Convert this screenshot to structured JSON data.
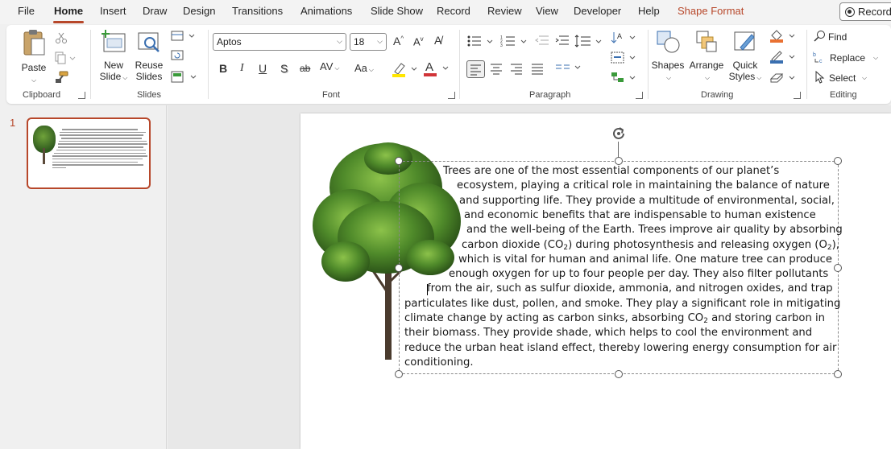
{
  "menu": {
    "file": "File",
    "home": "Home",
    "insert": "Insert",
    "draw": "Draw",
    "design": "Design",
    "transitions": "Transitions",
    "animations": "Animations",
    "slideshow": "Slide Show",
    "record": "Record",
    "review": "Review",
    "view": "View",
    "developer": "Developer",
    "help": "Help",
    "shape_format": "Shape Format",
    "record_button": "Record"
  },
  "ribbon": {
    "clipboard": {
      "label": "Clipboard",
      "paste": "Paste"
    },
    "slides": {
      "label": "Slides",
      "new_slide_1": "New",
      "new_slide_2": "Slide",
      "reuse_1": "Reuse",
      "reuse_2": "Slides"
    },
    "font": {
      "label": "Font",
      "family": "Aptos",
      "size": "18"
    },
    "paragraph": {
      "label": "Paragraph"
    },
    "drawing": {
      "label": "Drawing",
      "shapes": "Shapes",
      "arrange": "Arrange",
      "quick_styles_1": "Quick",
      "quick_styles_2": "Styles"
    },
    "editing": {
      "label": "Editing",
      "find": "Find",
      "replace": "Replace",
      "select": "Select"
    }
  },
  "thumbnails": {
    "slide_number": "1"
  },
  "slide": {
    "lines": [
      "Trees are one of the most essential components of our planet’s",
      "ecosystem, playing a critical role in maintaining the balance of nature",
      "and supporting life. They provide a multitude of environmental, social,",
      "and economic benefits that are indispensable to human existence",
      "and the well-being of the Earth. Trees improve air quality by absorbing",
      [
        "carbon dioxide (CO",
        "2",
        ") during photosynthesis and releasing oxygen (O",
        "2",
        "),"
      ],
      "which is vital for human and animal life. One mature tree can produce",
      "enough oxygen for up to four people per day. They also filter pollutants",
      "from the air, such as sulfur dioxide, ammonia, and nitrogen oxides, and trap",
      "particulates like dust, pollen, and smoke. They play a significant role in mitigating",
      [
        "climate change by acting as carbon sinks, absorbing CO",
        "2",
        " and storing carbon in"
      ],
      "their biomass. They provide shade, which helps to cool the environment and",
      "reduce the urban heat island effect, thereby lowering energy consumption for air",
      "conditioning."
    ]
  },
  "colors": {
    "accent": "#b7472a",
    "ribbon_bg": "#ffffff",
    "app_bg": "#f0f0f0"
  }
}
